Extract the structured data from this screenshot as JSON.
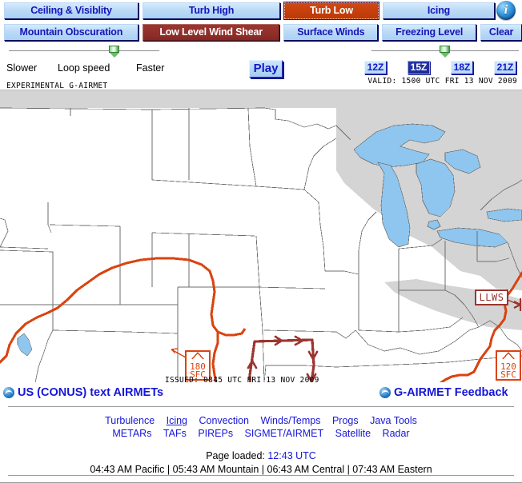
{
  "toolbar": {
    "row1": [
      {
        "id": "ceiling",
        "label": "Ceiling & Visiblity",
        "state": "normal"
      },
      {
        "id": "turbhigh",
        "label": "Turb High",
        "state": "normal"
      },
      {
        "id": "turblow",
        "label": "Turb Low",
        "state": "selected-orange"
      },
      {
        "id": "icing",
        "label": "Icing",
        "state": "normal"
      }
    ],
    "row2": [
      {
        "id": "mtnobs",
        "label": "Mountain Obscuration",
        "state": "normal"
      },
      {
        "id": "llws",
        "label": "Low Level Wind Shear",
        "state": "selected-maroon"
      },
      {
        "id": "sfcwinds",
        "label": "Surface Winds",
        "state": "normal"
      },
      {
        "id": "frzlevel",
        "label": "Freezing Level",
        "state": "normal"
      },
      {
        "id": "clear",
        "label": "Clear",
        "state": "normal"
      }
    ],
    "info_icon": "info-icon"
  },
  "controls": {
    "loop_slider": {
      "left_label": "Slower",
      "center_label": "Loop speed",
      "right_label": "Faster",
      "value_pct": 67
    },
    "play_label": "Play",
    "time_buttons": [
      {
        "label": "12Z",
        "active": false
      },
      {
        "label": "15Z",
        "active": true
      },
      {
        "label": "18Z",
        "active": false
      },
      {
        "label": "21Z",
        "active": false
      }
    ],
    "time_slider_value_pct": 50
  },
  "map": {
    "experimental_label": "EXPERIMENTAL G-AIRMET",
    "valid_label": "VALID: 1500 UTC FRI 13 NOV 2009",
    "issued_label": "ISSUED: 0845 UTC FRI 13 NOV 2009",
    "colors": {
      "land": "#ffffff",
      "canada": "#d4d4d4",
      "water": "#8ec6ef",
      "border": "#6e6e6e",
      "turb_low": "#9c3530",
      "llws": "#d94410"
    },
    "annotations": [
      {
        "id": "turblow-area-label",
        "text": "LLWS",
        "kind": "turb-low-box"
      },
      {
        "id": "llws-east-label",
        "text": "LLWS",
        "kind": "llws-box"
      },
      {
        "id": "alt-box-west",
        "top": "180",
        "bottom": "SFC",
        "kind": "altitude-box"
      },
      {
        "id": "alt-box-east",
        "top": "120",
        "bottom": "SFC",
        "kind": "altitude-box"
      }
    ]
  },
  "footer": {
    "conus_link": "US (CONUS) text AIRMETs",
    "feedback_link": "G-AIRMET Feedback",
    "nav_row1": [
      "Turbulence",
      "Icing",
      "Convection",
      "Winds/Temps",
      "Progs",
      "Java Tools"
    ],
    "nav_row2": [
      "METARs",
      "TAFs",
      "PIREPs",
      "SIGMET/AIRMET",
      "Satellite",
      "Radar"
    ],
    "page_loaded_label": "Page loaded:",
    "page_loaded_time": "12:43 UTC",
    "local_times": "04:43 AM Pacific  |  05:43 AM Mountain  |  06:43 AM Central  |  07:43 AM Eastern"
  }
}
